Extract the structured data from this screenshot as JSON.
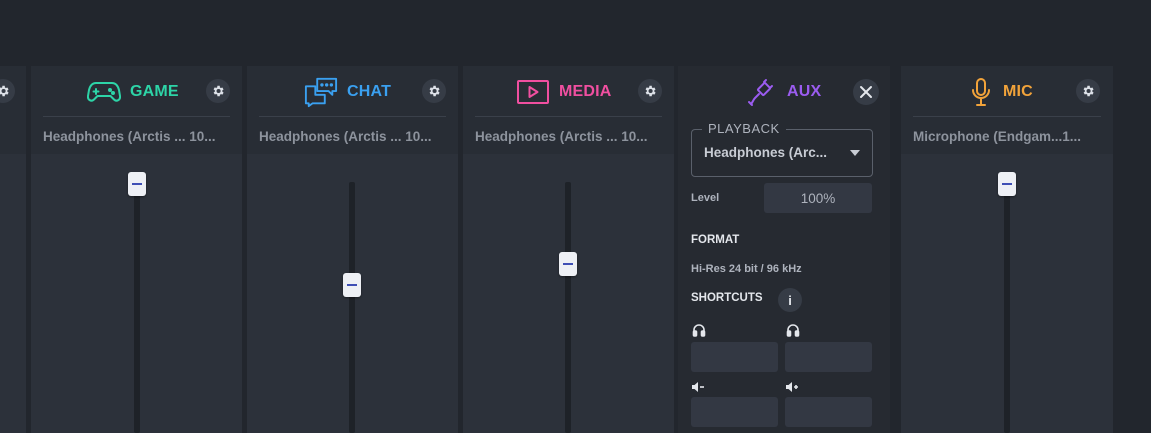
{
  "channels": [
    {
      "name": "GAME",
      "color": "#2dd4a7",
      "device": "Headphones (Arctis ... 10...",
      "level": 0.0,
      "icon": "gamepad-icon"
    },
    {
      "name": "CHAT",
      "color": "#3aa0f0",
      "device": "Headphones (Arctis ... 10...",
      "level": 0.43,
      "icon": "chat-bubbles-icon"
    },
    {
      "name": "MEDIA",
      "color": "#f04fa0",
      "device": "Headphones (Arctis ... 10...",
      "level": 0.33,
      "icon": "play-icon"
    },
    {
      "name": "MIC",
      "color": "#f2a33a",
      "device": "Microphone (Endgam...1...",
      "level": 0.0,
      "icon": "microphone-icon"
    }
  ],
  "aux": {
    "name": "AUX",
    "color": "#9b5cf0",
    "icon": "cable-icon",
    "playback_label": "PLAYBACK",
    "playback_value": "Headphones (Arc...",
    "level_label": "Level",
    "level_value": "100%",
    "format_label": "FORMAT",
    "format_value": "Hi-Res 24 bit / 96 kHz",
    "shortcuts_label": "SHORTCUTS",
    "info_label": "i"
  }
}
